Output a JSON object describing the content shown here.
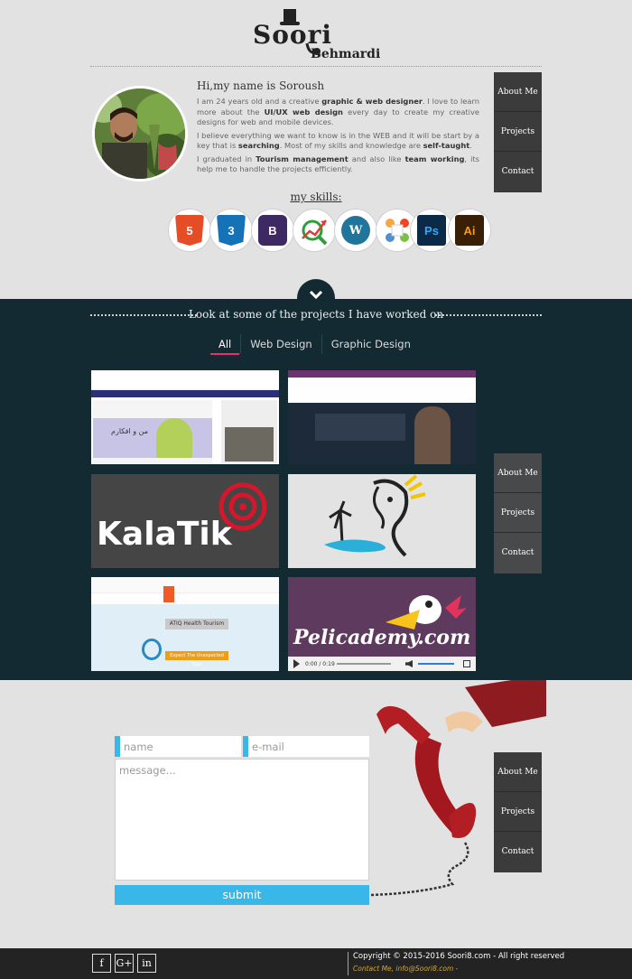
{
  "header": {
    "logo_primary": "Soori",
    "logo_secondary": "Behmardi"
  },
  "nav": {
    "about": "About Me",
    "projects": "Projects",
    "contact": "Contact"
  },
  "about": {
    "title": "Hi,my name is Soroush",
    "p1_a": "I am 24 years old and a creative ",
    "p1_b": "graphic & web designer",
    "p1_c": ". I love to learn more about the ",
    "p1_d": "UI/UX web design",
    "p1_e": " every day to create my creative designs for web and mobile devices.",
    "p2_a": "I believe everything we want to know is in the WEB and it will be start by a key that is ",
    "p2_b": "searching",
    "p2_c": ". Most of my skills and knowledge are ",
    "p2_d": "self-taught",
    "p2_e": ".",
    "p3_a": "I graduated in ",
    "p3_b": "Tourism management",
    "p3_c": " and also like ",
    "p3_d": "team working",
    "p3_e": ", its help me to handle the projects efficiently.",
    "skills_title": "my skills:",
    "skills": [
      {
        "name": "html5-icon",
        "label": "5",
        "color": "#e44d26"
      },
      {
        "name": "css3-icon",
        "label": "3",
        "color": "#1572b6"
      },
      {
        "name": "bootstrap-icon",
        "label": "B",
        "color": "#3d2a63"
      },
      {
        "name": "seo-growth-icon",
        "label": "",
        "color": "#2e9e3c"
      },
      {
        "name": "wordpress-icon",
        "label": "W",
        "color": "#21759b"
      },
      {
        "name": "joomla-icon",
        "label": "",
        "color": "#f44321"
      },
      {
        "name": "photoshop-icon",
        "label": "Ps",
        "color": "#0b2a48"
      },
      {
        "name": "illustrator-icon",
        "label": "Ai",
        "color": "#3a1f07"
      }
    ]
  },
  "projects": {
    "title": "Look at some of the projects I have worked on",
    "filters": [
      "All",
      "Web Design",
      "Graphic Design"
    ],
    "kalatik_label": "KalaTik",
    "pelicademy_label": "Pelicademy.com",
    "video_time": "0:00 / 0:19",
    "health_tourism_label": "ATIQ Health Tourism",
    "health_tourism_btn": "Expect The Unexpected Tour",
    "site1_text": "من و افکارم"
  },
  "contact": {
    "name_placeholder": "name",
    "email_placeholder": "e-mail",
    "message_placeholder": "message...",
    "submit_label": "submit"
  },
  "footer": {
    "social": [
      "f",
      "G+",
      "in"
    ],
    "copyright": "Copyright © 2015-2016 Soori8.com - All right reserved",
    "contact_line": "Contact Me, info@Soori8.com -"
  },
  "colors": {
    "accent_blue": "#38b7e8",
    "projects_bg": "#132a33",
    "filter_underline": "#e8316b",
    "nav_bg": "#3b3b3b"
  }
}
